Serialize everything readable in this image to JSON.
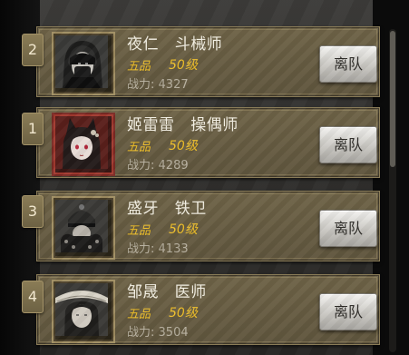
{
  "slot_numbers": [
    "2",
    "1",
    "3",
    "4"
  ],
  "members": [
    {
      "slot": "2",
      "name": "夜仁",
      "profession": "斗械师",
      "grade": "五品",
      "level": "50级",
      "power_label": "战力:",
      "power": "4327",
      "avatar": "hooded-masked-man"
    },
    {
      "slot": "1",
      "name": "姬雷雷",
      "profession": "操偶师",
      "grade": "五品",
      "level": "50级",
      "power_label": "战力:",
      "power": "4289",
      "avatar": "fox-eared-girl"
    },
    {
      "slot": "3",
      "name": "盛牙",
      "profession": "铁卫",
      "grade": "五品",
      "level": "50级",
      "power_label": "战力:",
      "power": "4133",
      "avatar": "armored-guard"
    },
    {
      "slot": "4",
      "name": "邹晟",
      "profession": "医师",
      "grade": "五品",
      "level": "50级",
      "power_label": "战力:",
      "power": "3504",
      "avatar": "straw-hat-healer"
    }
  ],
  "leave_button_label": "离队",
  "colors": {
    "card": "#6a5f44",
    "grade": "#f0c02a",
    "power": "#b7b09f",
    "name": "#f3efe3",
    "button": "#dcdad5"
  }
}
